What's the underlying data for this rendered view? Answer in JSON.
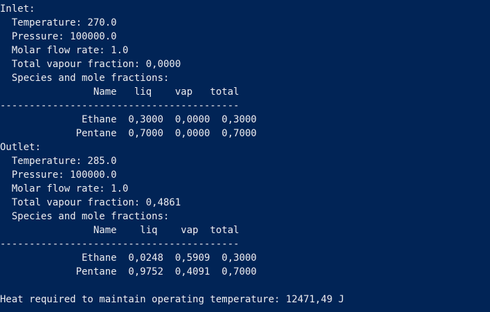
{
  "theme": {
    "background": "#012456",
    "foreground": "#eeedf0"
  },
  "lines": [
    "Inlet:",
    "  Temperature: 270.0",
    "  Pressure: 100000.0",
    "  Molar flow rate: 1.0",
    "  Total vapour fraction: 0,0000",
    "  Species and mole fractions:",
    "                Name   liq    vap   total",
    "-----------------------------------------",
    "              Ethane  0,3000  0,0000  0,3000",
    "             Pentane  0,7000  0,0000  0,7000",
    "Outlet:",
    "  Temperature: 285.0",
    "  Pressure: 100000.0",
    "  Molar flow rate: 1.0",
    "  Total vapour fraction: 0,4861",
    "  Species and mole fractions:",
    "                Name    liq    vap  total",
    "-----------------------------------------",
    "              Ethane  0,0248  0,5909  0,3000",
    "             Pentane  0,9752  0,4091  0,7000",
    "",
    "Heat required to maintain operating temperature: 12471,49 J"
  ]
}
